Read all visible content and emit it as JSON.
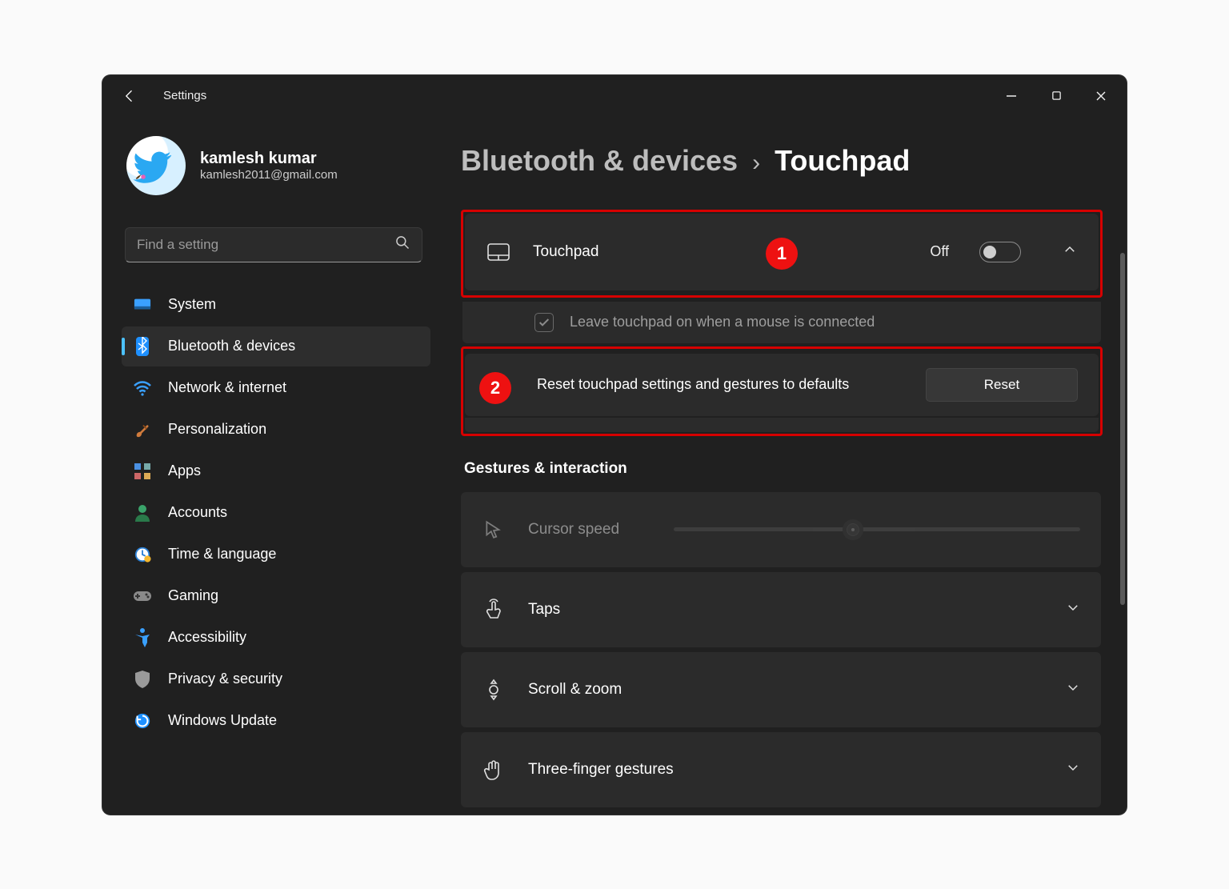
{
  "window": {
    "title": "Settings"
  },
  "profile": {
    "name": "kamlesh kumar",
    "email": "kamlesh2011@gmail.com"
  },
  "search": {
    "placeholder": "Find a setting"
  },
  "sidebar": {
    "items": [
      {
        "label": "System",
        "icon": "system"
      },
      {
        "label": "Bluetooth & devices",
        "icon": "bluetooth",
        "active": true
      },
      {
        "label": "Network & internet",
        "icon": "wifi"
      },
      {
        "label": "Personalization",
        "icon": "brush"
      },
      {
        "label": "Apps",
        "icon": "apps"
      },
      {
        "label": "Accounts",
        "icon": "account"
      },
      {
        "label": "Time & language",
        "icon": "clock"
      },
      {
        "label": "Gaming",
        "icon": "gamepad"
      },
      {
        "label": "Accessibility",
        "icon": "accessibility"
      },
      {
        "label": "Privacy & security",
        "icon": "shield"
      },
      {
        "label": "Windows Update",
        "icon": "update"
      }
    ]
  },
  "breadcrumb": {
    "parent": "Bluetooth & devices",
    "current": "Touchpad"
  },
  "touchpad_panel": {
    "title": "Touchpad",
    "toggle_state": "Off",
    "sub_option": "Leave touchpad on when a mouse is connected",
    "sub_checked": true,
    "reset_text": "Reset touchpad settings and gestures to defaults",
    "reset_button": "Reset"
  },
  "annotations": {
    "badge1": "1",
    "badge2": "2"
  },
  "gestures": {
    "heading": "Gestures & interaction",
    "cursor_speed": {
      "label": "Cursor speed",
      "value_pct": 44
    },
    "rows": [
      {
        "label": "Taps",
        "icon": "tap"
      },
      {
        "label": "Scroll & zoom",
        "icon": "scrollzoom"
      },
      {
        "label": "Three-finger gestures",
        "icon": "threefinger"
      }
    ]
  }
}
